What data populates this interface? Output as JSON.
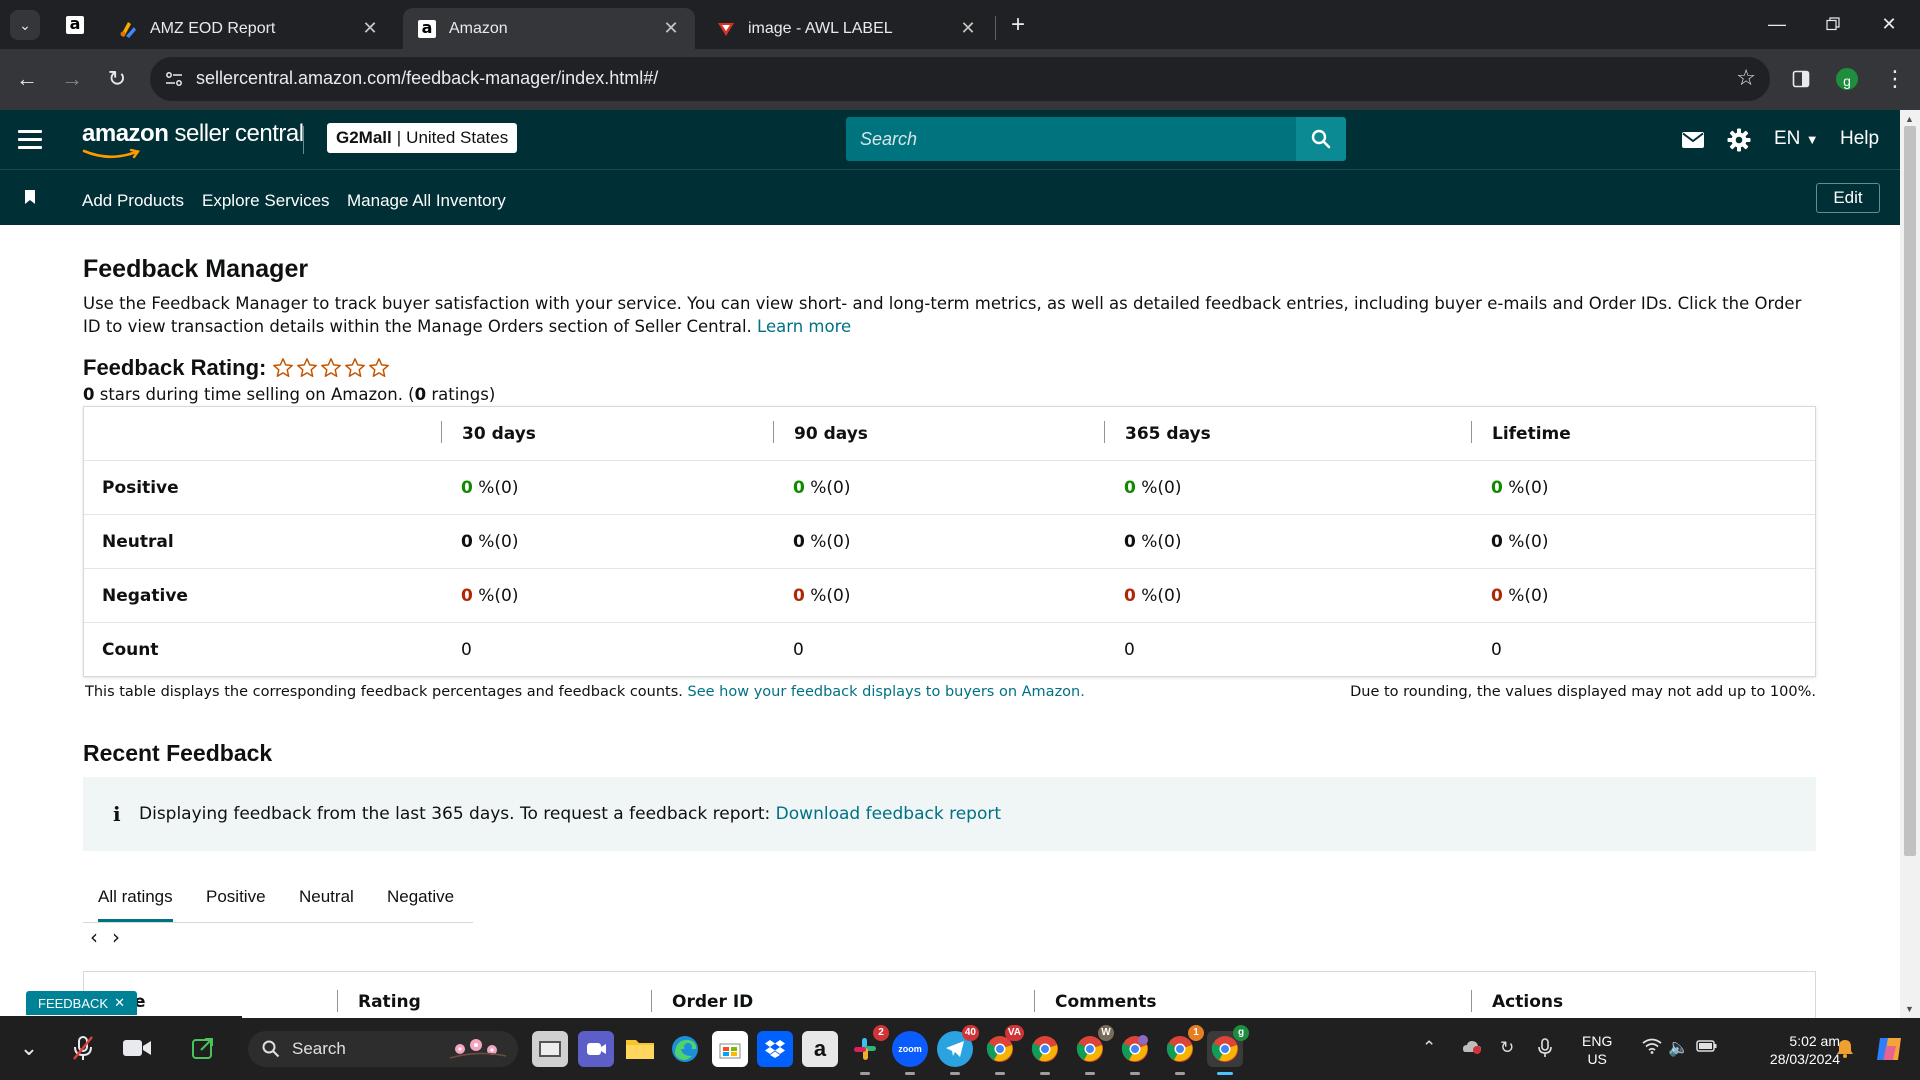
{
  "browser": {
    "tabs": [
      {
        "title": "AMZ EOD Report",
        "favicon": "google-apps-script-icon"
      },
      {
        "title": "Amazon",
        "favicon": "amazon-icon",
        "active": true
      },
      {
        "title": "image - AWL LABEL",
        "favicon": "awl-label-icon"
      }
    ],
    "pinned_tab_icon": "amazon-icon",
    "url": "sellercentral.amazon.com/feedback-manager/index.html#/",
    "profile_initial": "g"
  },
  "header": {
    "logo_bold": "amazon",
    "logo_rest": " seller central",
    "store_name": "G2Mall",
    "store_sep": "|",
    "store_region": "United States",
    "search_placeholder": "Search",
    "lang": "EN",
    "help": "Help"
  },
  "nav": {
    "links": [
      "Add Products",
      "Explore Services",
      "Manage All Inventory"
    ],
    "edit": "Edit"
  },
  "page": {
    "title": "Feedback Manager",
    "intro": "Use the Feedback Manager to track buyer satisfaction with your service. You can view short- and long-term metrics, as well as detailed feedback entries, including buyer e-mails and Order IDs. Click the Order ID to view transaction details within the Manage Orders section of Seller Central.",
    "learn_more": "Learn more",
    "rating_label": "Feedback Rating:",
    "stars_filled": 0,
    "stars_total": 5,
    "rating_stars": "0",
    "rating_sub_mid": " stars during time selling on Amazon. (",
    "rating_count": "0",
    "rating_sub_end": " ratings)"
  },
  "feedback_table": {
    "columns": [
      "30 days",
      "90 days",
      "365 days",
      "Lifetime"
    ],
    "rows": [
      {
        "label": "Positive",
        "values": [
          "0",
          "0",
          "0",
          "0"
        ],
        "counts": [
          "%(0)",
          "%(0)",
          "%(0)",
          "%(0)"
        ],
        "color": "#118a00"
      },
      {
        "label": "Neutral",
        "values": [
          "0",
          "0",
          "0",
          "0"
        ],
        "counts": [
          "%(0)",
          "%(0)",
          "%(0)",
          "%(0)"
        ],
        "color": "#0f1111"
      },
      {
        "label": "Negative",
        "values": [
          "0",
          "0",
          "0",
          "0"
        ],
        "counts": [
          "%(0)",
          "%(0)",
          "%(0)",
          "%(0)"
        ],
        "color": "#b12704"
      },
      {
        "label": "Count",
        "values": [
          "0",
          "0",
          "0",
          "0"
        ]
      }
    ],
    "note": "This table displays the corresponding feedback percentages and feedback counts. ",
    "note_link": "See how your feedback displays to buyers on Amazon.",
    "rounding_note": "Due to rounding, the values displayed may not add up to 100%."
  },
  "recent": {
    "title": "Recent Feedback",
    "info_text": "Displaying feedback from the last 365 days. To request a feedback report: ",
    "info_link": "Download feedback report",
    "tabs": [
      "All ratings",
      "Positive",
      "Neutral",
      "Negative"
    ],
    "active_tab": "All ratings",
    "table_headers": [
      "e",
      "Rating",
      "Order ID",
      "Comments",
      "Actions"
    ]
  },
  "feedback_tab": "FEEDBACK",
  "taskbar": {
    "search": "Search",
    "lang_line1": "ENG",
    "lang_line2": "US",
    "time": "5:02 am",
    "date": "28/03/2024",
    "badges": {
      "slack": "2",
      "telegram": "40",
      "chrome_va": "VA",
      "chrome_w": "W",
      "chrome_1": "1",
      "chrome_g": "g"
    }
  },
  "colors": {
    "header_bg": "#002f36",
    "search_bg": "#00747e",
    "link": "#007185",
    "positive": "#118a00",
    "negative": "#b12704",
    "star": "#c45500"
  }
}
